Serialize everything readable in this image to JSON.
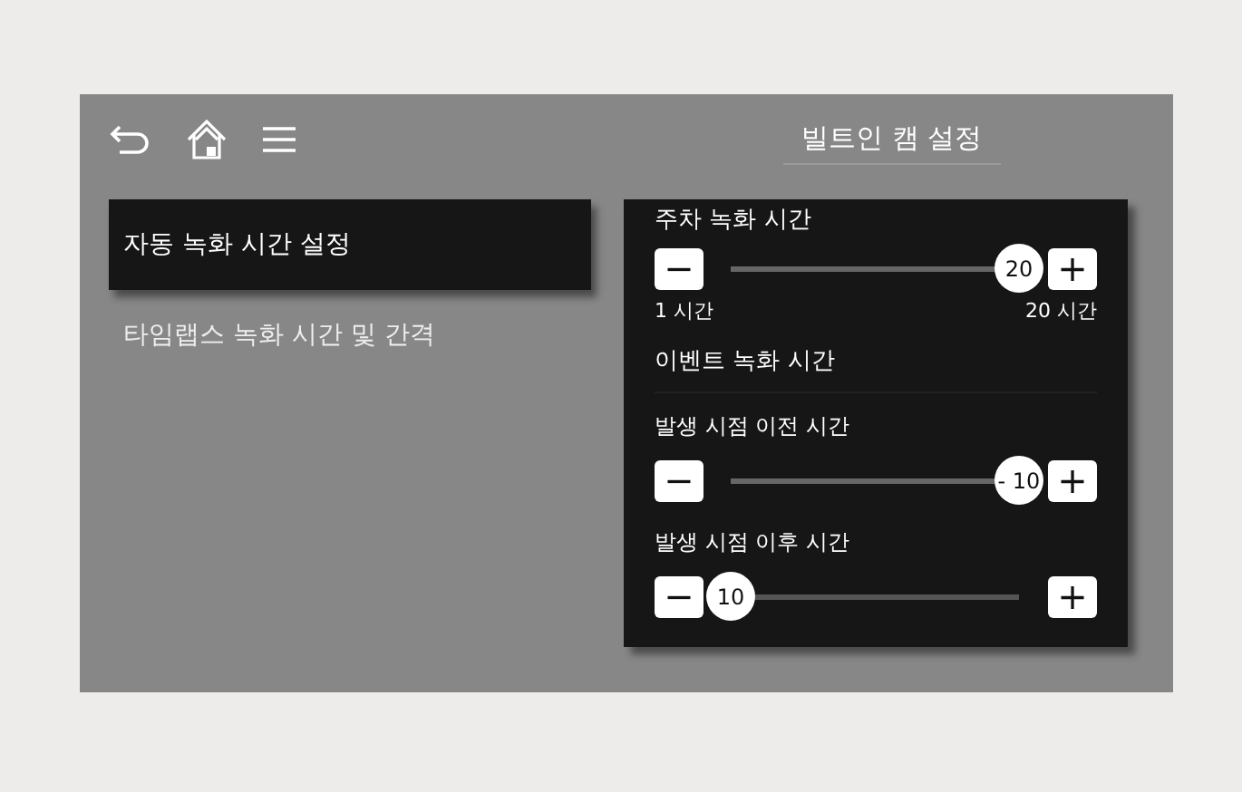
{
  "toolbar": {
    "title": "빌트인 캠 설정"
  },
  "menu": [
    {
      "label": "자동 녹화 시간 설정",
      "selected": true
    },
    {
      "label": "타임랩스 녹화 시간 및 간격",
      "selected": false
    }
  ],
  "parking": {
    "title": "주차 녹화 시간",
    "minus": "−",
    "plus": "+",
    "value": "20",
    "level": 1,
    "min_label": "1 시간",
    "max_label": "20 시간"
  },
  "event": {
    "title": "이벤트 녹화 시간",
    "sliders": [
      {
        "label": "발생 시점 이전 시간",
        "minus": "−",
        "plus": "+",
        "value": "- 10",
        "level": 1
      },
      {
        "label": "발생 시점 이후 시간",
        "minus": "−",
        "plus": "+",
        "value": "10",
        "level": 0
      }
    ]
  }
}
